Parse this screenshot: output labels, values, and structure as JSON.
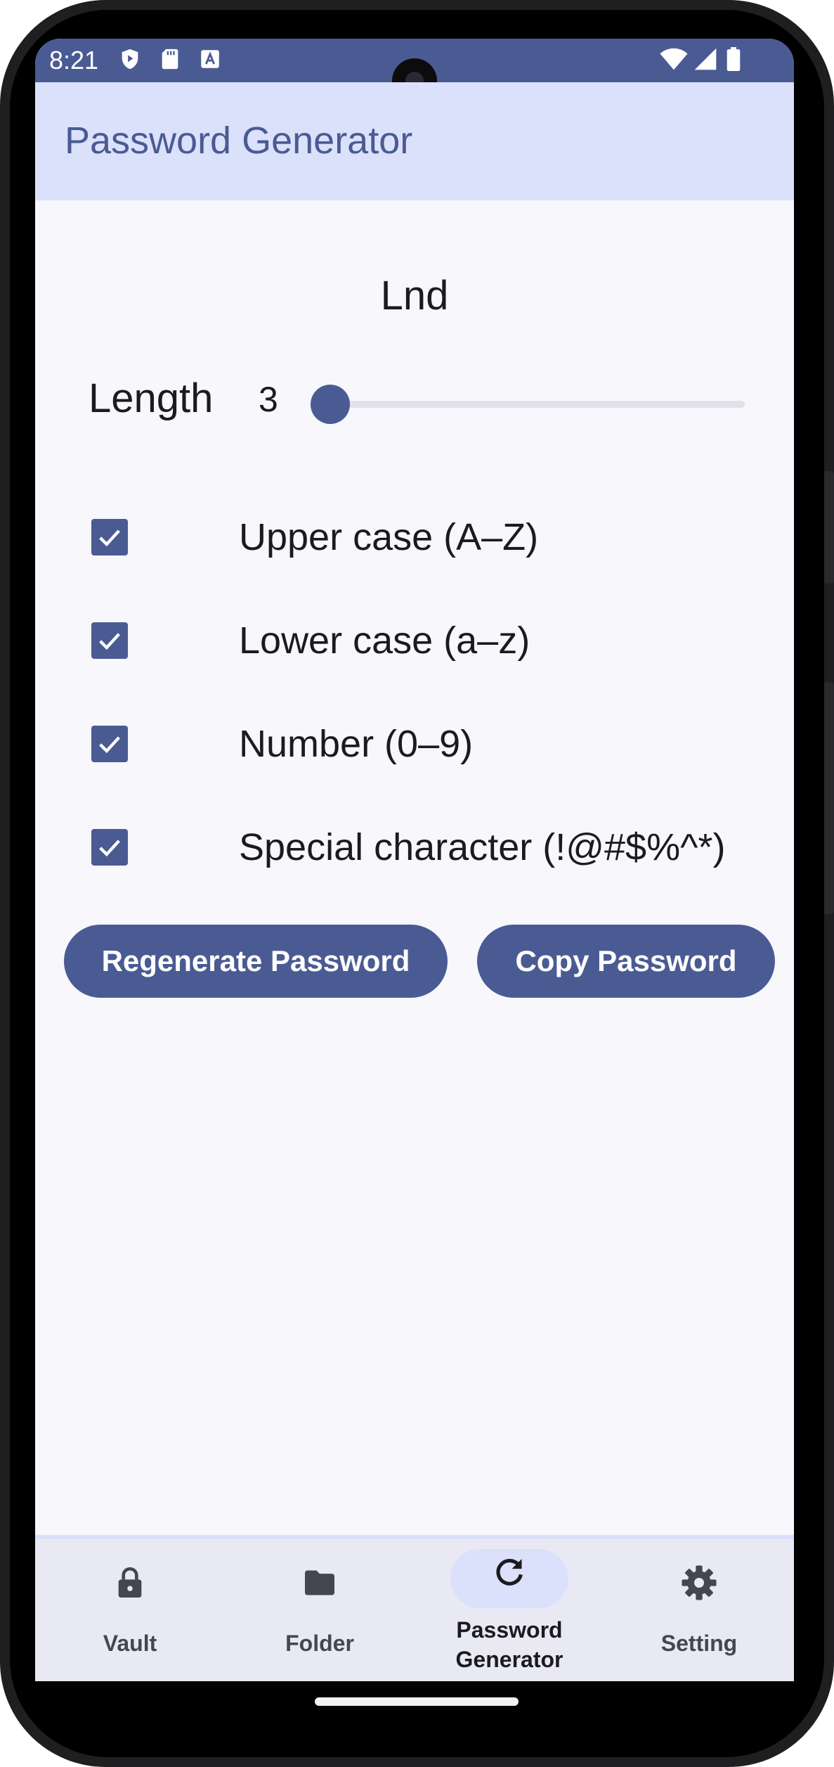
{
  "status": {
    "time": "8:21"
  },
  "appbar": {
    "title": "Password Generator"
  },
  "generator": {
    "password": "Lnd",
    "length_label": "Length",
    "length_value": "3",
    "slider_fraction": 0.0,
    "options": [
      {
        "label": "Upper case (A–Z)",
        "checked": true
      },
      {
        "label": "Lower case (a–z)",
        "checked": true
      },
      {
        "label": "Number (0–9)",
        "checked": true
      },
      {
        "label": "Special character (!@#$%^*)",
        "checked": true
      }
    ],
    "regenerate_label": "Regenerate Password",
    "copy_label": "Copy Password"
  },
  "nav": {
    "items": [
      {
        "label": "Vault",
        "icon": "lock-icon",
        "selected": false
      },
      {
        "label": "Folder",
        "icon": "folder-icon",
        "selected": false
      },
      {
        "label_line1": "Password",
        "label_line2": "Generator",
        "icon": "refresh-icon",
        "selected": true
      },
      {
        "label": "Setting",
        "icon": "gear-icon",
        "selected": false
      }
    ]
  },
  "colors": {
    "primary": "#4a5b93",
    "appbar_bg": "#dbe1fb",
    "surface": "#f7f7fc",
    "nav_bg": "#e9e9f3"
  }
}
